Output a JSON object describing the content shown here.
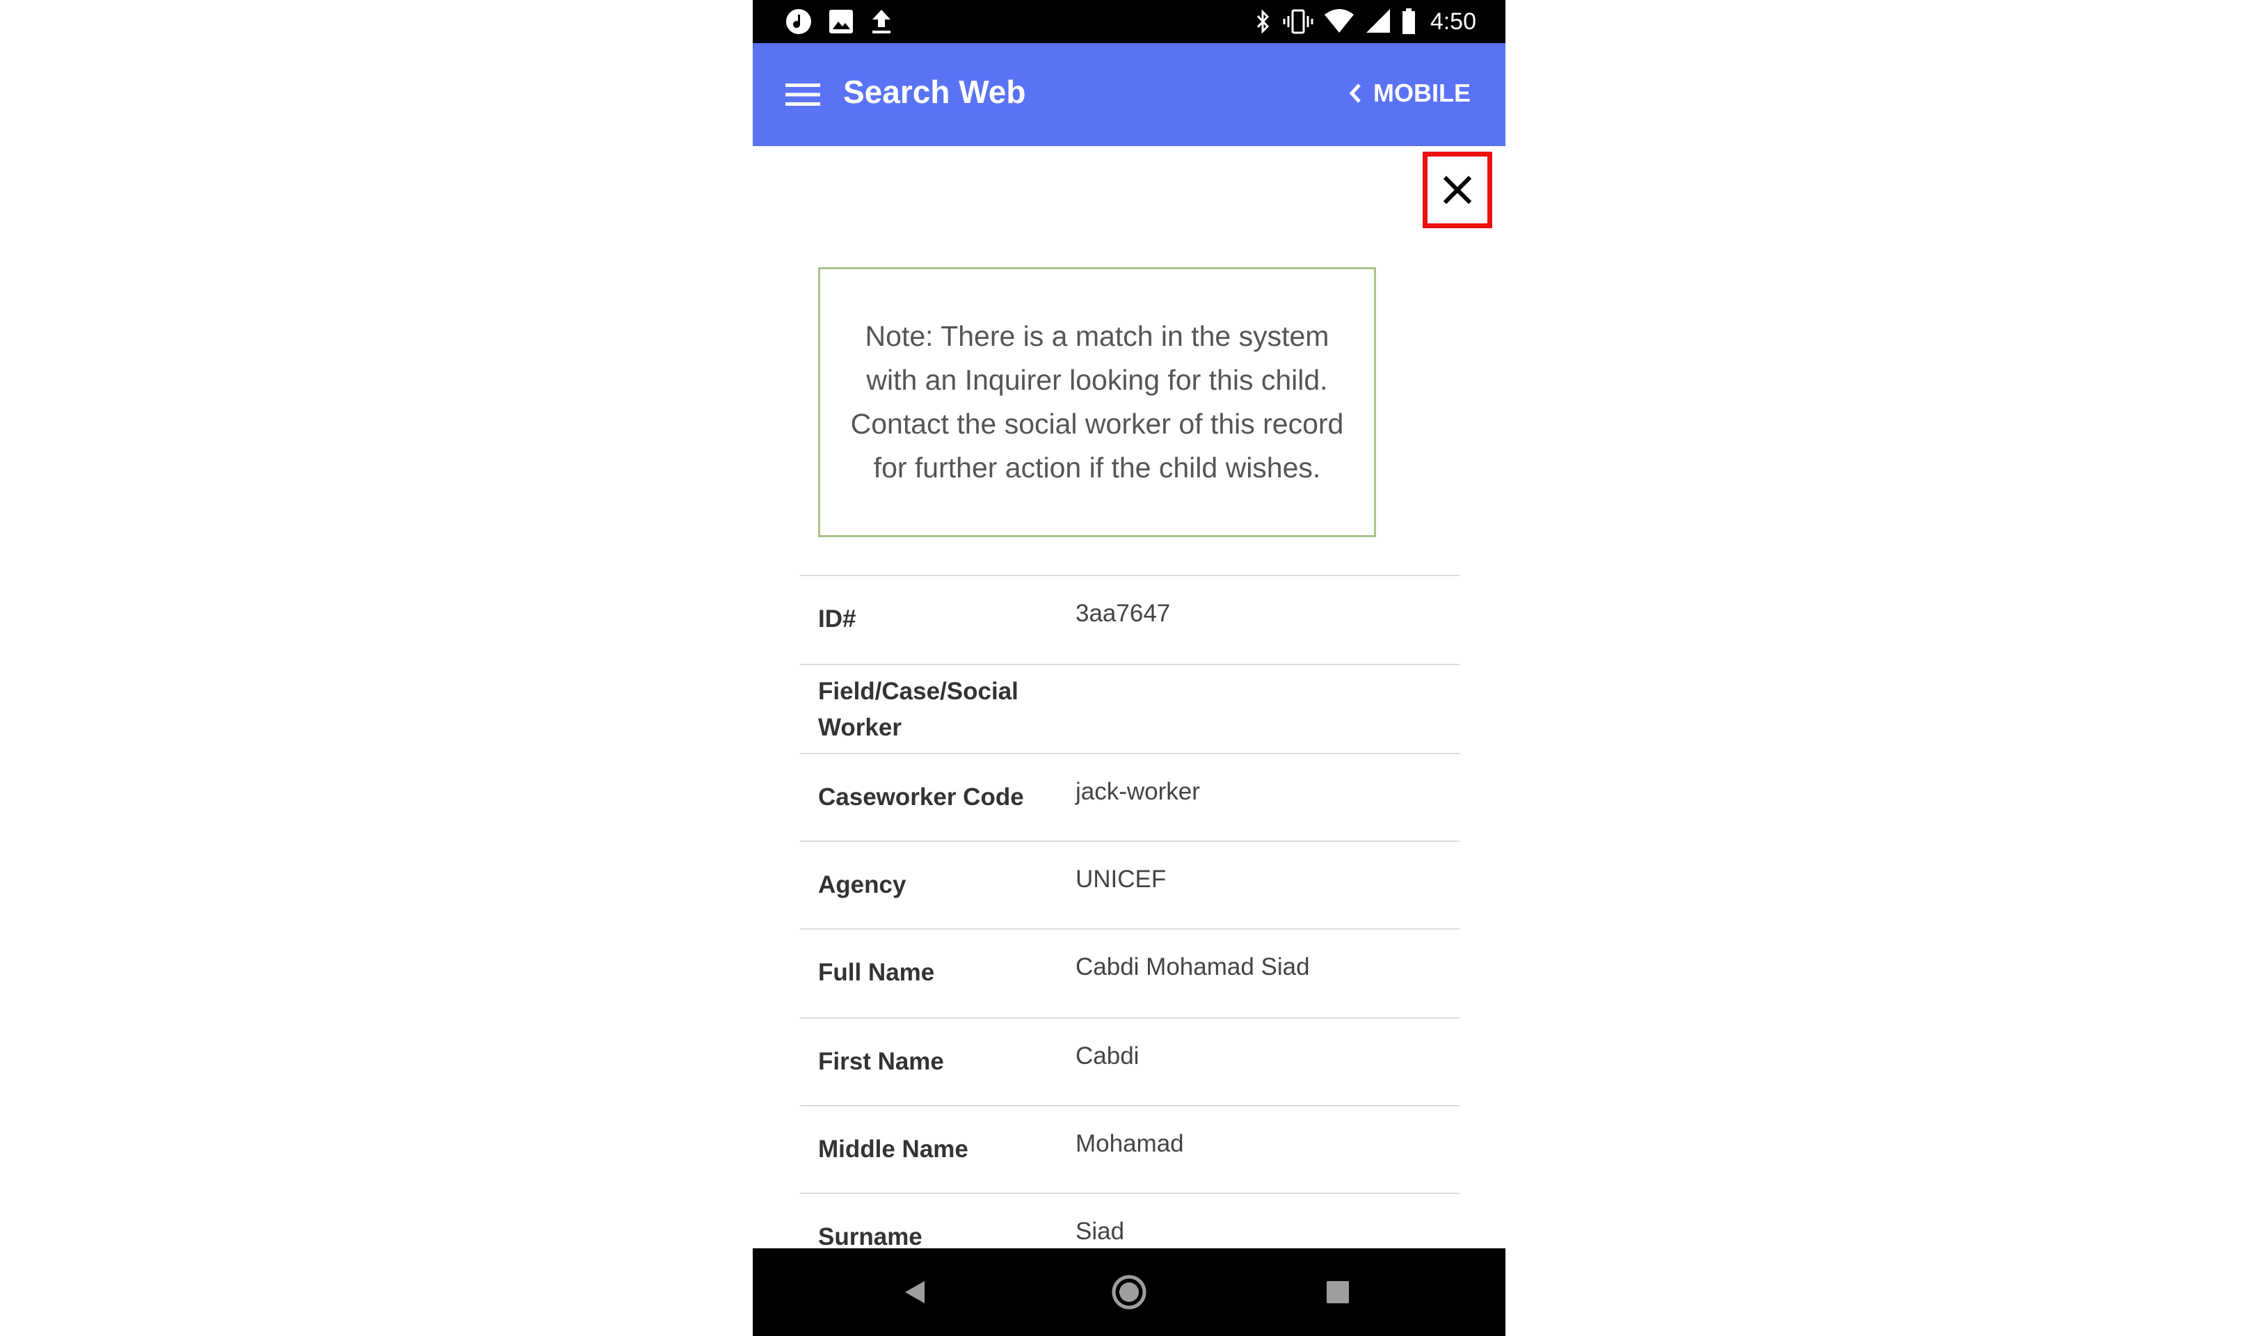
{
  "status_bar": {
    "time": "4:50",
    "left_icons": [
      "music-icon",
      "image-icon",
      "upload-icon"
    ],
    "right_icons": [
      "bluetooth-icon",
      "vibrate-icon",
      "wifi-icon",
      "signal-icon",
      "battery-icon"
    ]
  },
  "app_bar": {
    "title": "Search Web",
    "mobile_label": "MOBILE",
    "background": "#5a73f5"
  },
  "note": {
    "text": "Note: There is a match in the system with an Inquirer looking for this child. Contact the social worker of this record for further action if the child wishes."
  },
  "details": [
    {
      "label": "ID#",
      "value": "3aa7647"
    },
    {
      "label": "Field/Case/Social Worker",
      "value": ""
    },
    {
      "label": "Caseworker Code",
      "value": "jack-worker"
    },
    {
      "label": "Agency",
      "value": "UNICEF"
    },
    {
      "label": "Full Name",
      "value": "Cabdi Mohamad Siad"
    },
    {
      "label": "First Name",
      "value": "Cabdi"
    },
    {
      "label": "Middle Name",
      "value": "Mohamad"
    },
    {
      "label": "Surname",
      "value": "Siad"
    }
  ],
  "colors": {
    "close_highlight": "#ee1111",
    "note_border": "#a9c48a"
  }
}
